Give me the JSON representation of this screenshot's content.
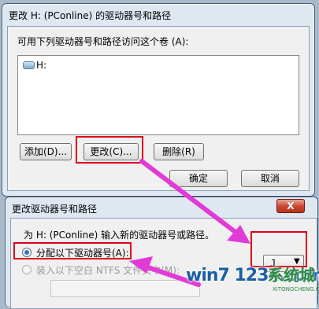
{
  "dialog1": {
    "title": "更改 H: (PConline) 的驱动器号和路径",
    "access_label": "可用下列驱动器号和路径访问这个卷 (A):",
    "list_items": [
      {
        "label": "H:",
        "icon": "drive-icon"
      }
    ],
    "add_label": "添加(D)...",
    "change_label": "更改(C)...",
    "delete_label": "删除(R)",
    "ok_label": "确定",
    "cancel_label": "取消"
  },
  "dialog2": {
    "title": "更改驱动器号和路径",
    "close_label": "X",
    "prompt": "为 H: (PConline) 输入新的驱动器号或路径。",
    "option_assign": "分配以下驱动器号(A):",
    "option_mount": "装入以下空白 NTFS 文件夹中(M):",
    "drive_letter_value": "J",
    "assign_selected": true
  },
  "watermark": {
    "site": "win7 1234.com",
    "brand": "系统城",
    "sub": "XITONGCHENG.COM"
  },
  "colors": {
    "highlight": "#e0001b",
    "arrow": "#e23ad6"
  }
}
